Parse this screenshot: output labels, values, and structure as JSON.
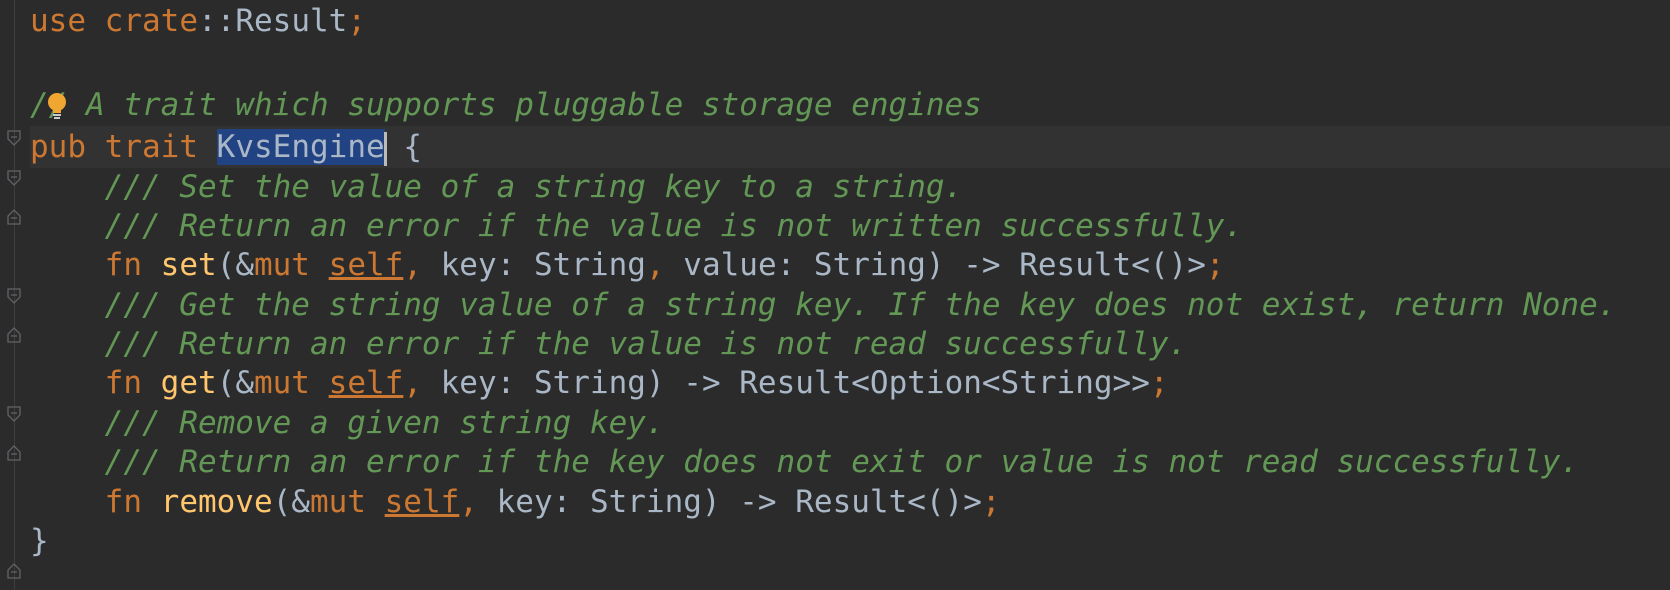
{
  "code": {
    "line1": {
      "kw_use": "use",
      "kw_crate": "crate",
      "rest": "::Result",
      "semi": ";"
    },
    "line3": {
      "comment_a": "/",
      "comment_b": "/ A trait which supports pluggable storage engines"
    },
    "line4": {
      "kw_pub": "pub",
      "kw_trait": "trait",
      "name": "KvsEngine",
      "brace": " {"
    },
    "line5": {
      "comment": "/// Set the value of a string key to a string."
    },
    "line6": {
      "comment": "/// Return an error if the value is not written successfully."
    },
    "line7": {
      "kw_fn": "fn",
      "name": "set",
      "p1": "(&",
      "kw_mut": "mut",
      "self": "self",
      "comma1": ",",
      "p2": " key: String",
      "comma2": ",",
      "p3": " value: String) -> Result<()>",
      "semi": ";"
    },
    "line8": {
      "comment": "/// Get the string value of a string key. If the key does not exist, return None."
    },
    "line9": {
      "comment": "/// Return an error if the value is not read successfully."
    },
    "line10": {
      "kw_fn": "fn",
      "name": "get",
      "p1": "(&",
      "kw_mut": "mut",
      "self": "self",
      "comma1": ",",
      "p2": " key: String) -> Result<Option<String>>",
      "semi": ";"
    },
    "line11": {
      "comment": "/// Remove a given string key."
    },
    "line12": {
      "comment": "/// Return an error if the key does not exit or value is not read successfully."
    },
    "line13": {
      "kw_fn": "fn",
      "name": "remove",
      "p1": "(&",
      "kw_mut": "mut",
      "self": "self",
      "comma1": ",",
      "p2": " key: String) -> Result<()>",
      "semi": ";"
    },
    "line14": {
      "brace": "}"
    }
  },
  "icons": {
    "bulb": "lightbulb-icon",
    "fold": "fold-marker-icon"
  },
  "colors": {
    "background": "#2b2b2b",
    "current_line": "#323232",
    "keyword": "#cc7832",
    "comment": "#629755",
    "function": "#ffc66d",
    "text": "#a9b7c6",
    "selection": "#214283"
  }
}
